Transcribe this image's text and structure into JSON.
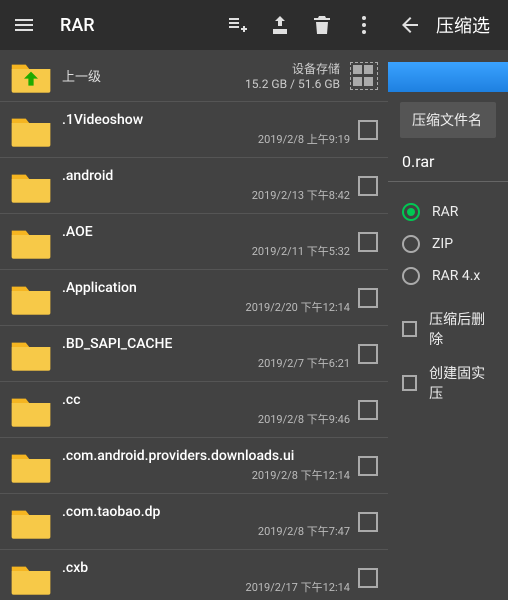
{
  "left": {
    "title": "RAR",
    "storage": {
      "up_label": "上一级",
      "device_label": "设备存储",
      "usage": "15.2 GB / 51.6 GB"
    },
    "items": [
      {
        "name": ".1Videoshow",
        "date": "2019/2/8 上午9:19"
      },
      {
        "name": ".android",
        "date": "2019/2/13 下午8:42"
      },
      {
        "name": ".AOE",
        "date": "2019/2/11 下午5:32"
      },
      {
        "name": ".Application",
        "date": "2019/2/20 下午12:14"
      },
      {
        "name": ".BD_SAPI_CACHE",
        "date": "2019/2/7 下午6:21"
      },
      {
        "name": ".cc",
        "date": "2019/2/8 下午9:46"
      },
      {
        "name": ".com.android.providers.downloads.ui",
        "date": "2019/2/8 下午12:14"
      },
      {
        "name": ".com.taobao.dp",
        "date": "2019/2/8 下午7:47"
      },
      {
        "name": ".cxb",
        "date": "2019/2/17 下午12:14"
      }
    ]
  },
  "right": {
    "title": "压缩选",
    "filename_button": "压缩文件名",
    "archive_name": "0.rar",
    "formats": [
      {
        "label": "RAR",
        "selected": true
      },
      {
        "label": "ZIP",
        "selected": false
      },
      {
        "label": "RAR 4.x",
        "selected": false
      }
    ],
    "options": [
      {
        "label": "压缩后删除"
      },
      {
        "label": "创建固实压"
      }
    ]
  }
}
